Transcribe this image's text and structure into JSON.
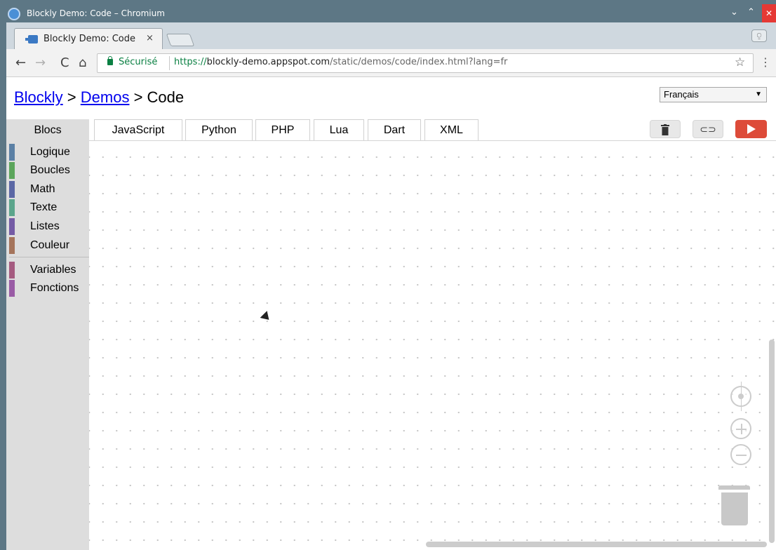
{
  "window": {
    "title": "Blockly Demo: Code – Chromium",
    "minimize_glyph": "⌄",
    "maximize_glyph": "⌃",
    "close_glyph": "✕"
  },
  "browser": {
    "tab_title": "Blockly Demo: Code",
    "tab_close": "×",
    "secure_label": "Sécurisé",
    "url_scheme": "https://",
    "url_host": "blockly-demo.appspot.com",
    "url_path": "/static/demos/code/index.html?lang=fr",
    "back_glyph": "←",
    "forward_glyph": "→",
    "reload_glyph": "C",
    "home_glyph": "⌂",
    "star_glyph": "☆",
    "menu_glyph": "⋮",
    "profile_glyph": "⍜"
  },
  "page": {
    "breadcrumb": {
      "link1": "Blockly",
      "sep1": " > ",
      "link2": "Demos",
      "sep2": " > ",
      "current": "Code"
    },
    "language_select": {
      "selected": "Français",
      "caret": "▼"
    },
    "tabs": [
      "Blocs",
      "JavaScript",
      "Python",
      "PHP",
      "Lua",
      "Dart",
      "XML"
    ],
    "selected_tab": "Blocs",
    "buttons": {
      "trash_glyph": "🗑",
      "link_glyph": "⊂⊃",
      "run_glyph": "▶"
    }
  },
  "toolbox": {
    "categories": [
      {
        "label": "Logique",
        "color": "#5b80a5"
      },
      {
        "label": "Boucles",
        "color": "#5ba55b"
      },
      {
        "label": "Math",
        "color": "#5b67a5"
      },
      {
        "label": "Texte",
        "color": "#5ba58c"
      },
      {
        "label": "Listes",
        "color": "#745ba5"
      },
      {
        "label": "Couleur",
        "color": "#a5745b"
      },
      {
        "label": "Variables",
        "color": "#a55b80"
      },
      {
        "label": "Fonctions",
        "color": "#995ba5"
      }
    ]
  },
  "colors": {
    "run_button": "#dd4b39",
    "link": "#0000ee",
    "titlebar": "#5d7785",
    "secure_green": "#0b8043"
  }
}
